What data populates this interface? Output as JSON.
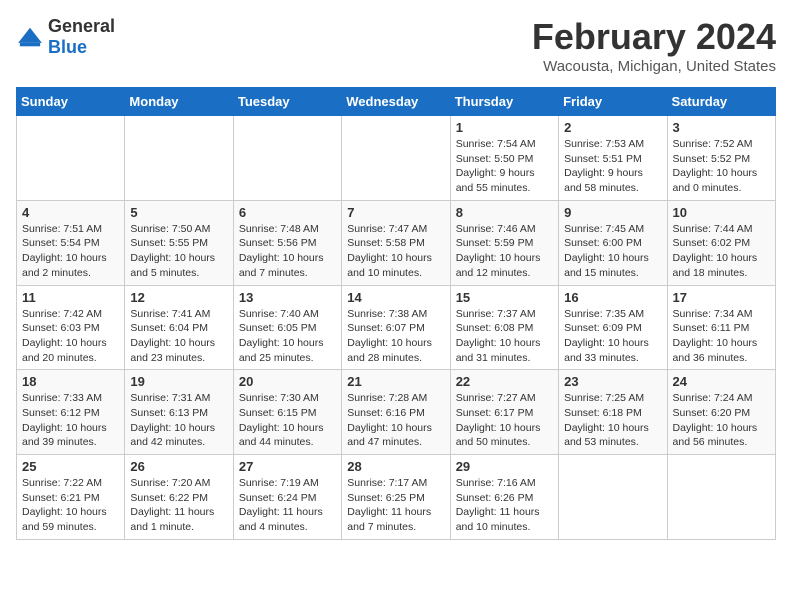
{
  "logo": {
    "general": "General",
    "blue": "Blue"
  },
  "title": "February 2024",
  "subtitle": "Wacousta, Michigan, United States",
  "headers": [
    "Sunday",
    "Monday",
    "Tuesday",
    "Wednesday",
    "Thursday",
    "Friday",
    "Saturday"
  ],
  "weeks": [
    [
      {
        "day": "",
        "info": ""
      },
      {
        "day": "",
        "info": ""
      },
      {
        "day": "",
        "info": ""
      },
      {
        "day": "",
        "info": ""
      },
      {
        "day": "1",
        "info": "Sunrise: 7:54 AM\nSunset: 5:50 PM\nDaylight: 9 hours and 55 minutes."
      },
      {
        "day": "2",
        "info": "Sunrise: 7:53 AM\nSunset: 5:51 PM\nDaylight: 9 hours and 58 minutes."
      },
      {
        "day": "3",
        "info": "Sunrise: 7:52 AM\nSunset: 5:52 PM\nDaylight: 10 hours and 0 minutes."
      }
    ],
    [
      {
        "day": "4",
        "info": "Sunrise: 7:51 AM\nSunset: 5:54 PM\nDaylight: 10 hours and 2 minutes."
      },
      {
        "day": "5",
        "info": "Sunrise: 7:50 AM\nSunset: 5:55 PM\nDaylight: 10 hours and 5 minutes."
      },
      {
        "day": "6",
        "info": "Sunrise: 7:48 AM\nSunset: 5:56 PM\nDaylight: 10 hours and 7 minutes."
      },
      {
        "day": "7",
        "info": "Sunrise: 7:47 AM\nSunset: 5:58 PM\nDaylight: 10 hours and 10 minutes."
      },
      {
        "day": "8",
        "info": "Sunrise: 7:46 AM\nSunset: 5:59 PM\nDaylight: 10 hours and 12 minutes."
      },
      {
        "day": "9",
        "info": "Sunrise: 7:45 AM\nSunset: 6:00 PM\nDaylight: 10 hours and 15 minutes."
      },
      {
        "day": "10",
        "info": "Sunrise: 7:44 AM\nSunset: 6:02 PM\nDaylight: 10 hours and 18 minutes."
      }
    ],
    [
      {
        "day": "11",
        "info": "Sunrise: 7:42 AM\nSunset: 6:03 PM\nDaylight: 10 hours and 20 minutes."
      },
      {
        "day": "12",
        "info": "Sunrise: 7:41 AM\nSunset: 6:04 PM\nDaylight: 10 hours and 23 minutes."
      },
      {
        "day": "13",
        "info": "Sunrise: 7:40 AM\nSunset: 6:05 PM\nDaylight: 10 hours and 25 minutes."
      },
      {
        "day": "14",
        "info": "Sunrise: 7:38 AM\nSunset: 6:07 PM\nDaylight: 10 hours and 28 minutes."
      },
      {
        "day": "15",
        "info": "Sunrise: 7:37 AM\nSunset: 6:08 PM\nDaylight: 10 hours and 31 minutes."
      },
      {
        "day": "16",
        "info": "Sunrise: 7:35 AM\nSunset: 6:09 PM\nDaylight: 10 hours and 33 minutes."
      },
      {
        "day": "17",
        "info": "Sunrise: 7:34 AM\nSunset: 6:11 PM\nDaylight: 10 hours and 36 minutes."
      }
    ],
    [
      {
        "day": "18",
        "info": "Sunrise: 7:33 AM\nSunset: 6:12 PM\nDaylight: 10 hours and 39 minutes."
      },
      {
        "day": "19",
        "info": "Sunrise: 7:31 AM\nSunset: 6:13 PM\nDaylight: 10 hours and 42 minutes."
      },
      {
        "day": "20",
        "info": "Sunrise: 7:30 AM\nSunset: 6:15 PM\nDaylight: 10 hours and 44 minutes."
      },
      {
        "day": "21",
        "info": "Sunrise: 7:28 AM\nSunset: 6:16 PM\nDaylight: 10 hours and 47 minutes."
      },
      {
        "day": "22",
        "info": "Sunrise: 7:27 AM\nSunset: 6:17 PM\nDaylight: 10 hours and 50 minutes."
      },
      {
        "day": "23",
        "info": "Sunrise: 7:25 AM\nSunset: 6:18 PM\nDaylight: 10 hours and 53 minutes."
      },
      {
        "day": "24",
        "info": "Sunrise: 7:24 AM\nSunset: 6:20 PM\nDaylight: 10 hours and 56 minutes."
      }
    ],
    [
      {
        "day": "25",
        "info": "Sunrise: 7:22 AM\nSunset: 6:21 PM\nDaylight: 10 hours and 59 minutes."
      },
      {
        "day": "26",
        "info": "Sunrise: 7:20 AM\nSunset: 6:22 PM\nDaylight: 11 hours and 1 minute."
      },
      {
        "day": "27",
        "info": "Sunrise: 7:19 AM\nSunset: 6:24 PM\nDaylight: 11 hours and 4 minutes."
      },
      {
        "day": "28",
        "info": "Sunrise: 7:17 AM\nSunset: 6:25 PM\nDaylight: 11 hours and 7 minutes."
      },
      {
        "day": "29",
        "info": "Sunrise: 7:16 AM\nSunset: 6:26 PM\nDaylight: 11 hours and 10 minutes."
      },
      {
        "day": "",
        "info": ""
      },
      {
        "day": "",
        "info": ""
      }
    ]
  ]
}
